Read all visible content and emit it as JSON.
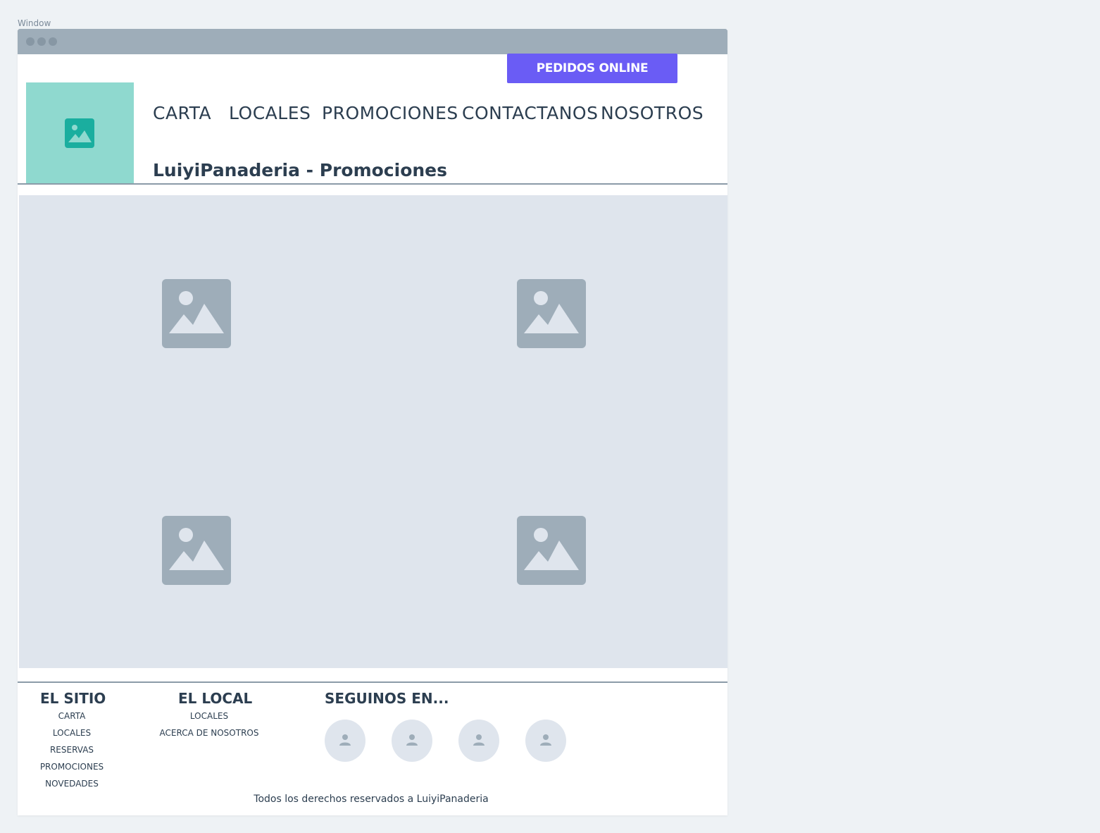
{
  "window": {
    "label": "Window"
  },
  "header": {
    "order_button": "PEDIDOS ONLINE",
    "nav": [
      {
        "label": "CARTA"
      },
      {
        "label": "LOCALES"
      },
      {
        "label": "PROMOCIONES"
      },
      {
        "label": "CONTACTANOS"
      },
      {
        "label": "NOSOTROS"
      }
    ],
    "page_title": "LuiyiPanaderia - Promociones",
    "logo_icon": "image-icon"
  },
  "promotions": {
    "images": [
      {
        "icon": "image-placeholder-icon"
      },
      {
        "icon": "image-placeholder-icon"
      },
      {
        "icon": "image-placeholder-icon"
      },
      {
        "icon": "image-placeholder-icon"
      }
    ]
  },
  "footer": {
    "site": {
      "heading": "EL SITIO",
      "links": [
        "CARTA",
        "LOCALES",
        "RESERVAS",
        "PROMOCIONES",
        "NOVEDADES"
      ]
    },
    "local": {
      "heading": "EL LOCAL",
      "links": [
        "LOCALES",
        "ACERCA DE NOSOTROS"
      ]
    },
    "social": {
      "heading": "SEGUINOS EN...",
      "icons": [
        "user-icon",
        "user-icon",
        "user-icon",
        "user-icon"
      ]
    },
    "copyright": "Todos los derechos reservados a LuiyiPanaderia"
  },
  "colors": {
    "accent": "#6a5cf5",
    "logo_bg": "#8fd9cf",
    "logo_icon": "#1aae9f",
    "placeholder_bg": "#dfe5ed",
    "placeholder_icon": "#9eadb9"
  }
}
